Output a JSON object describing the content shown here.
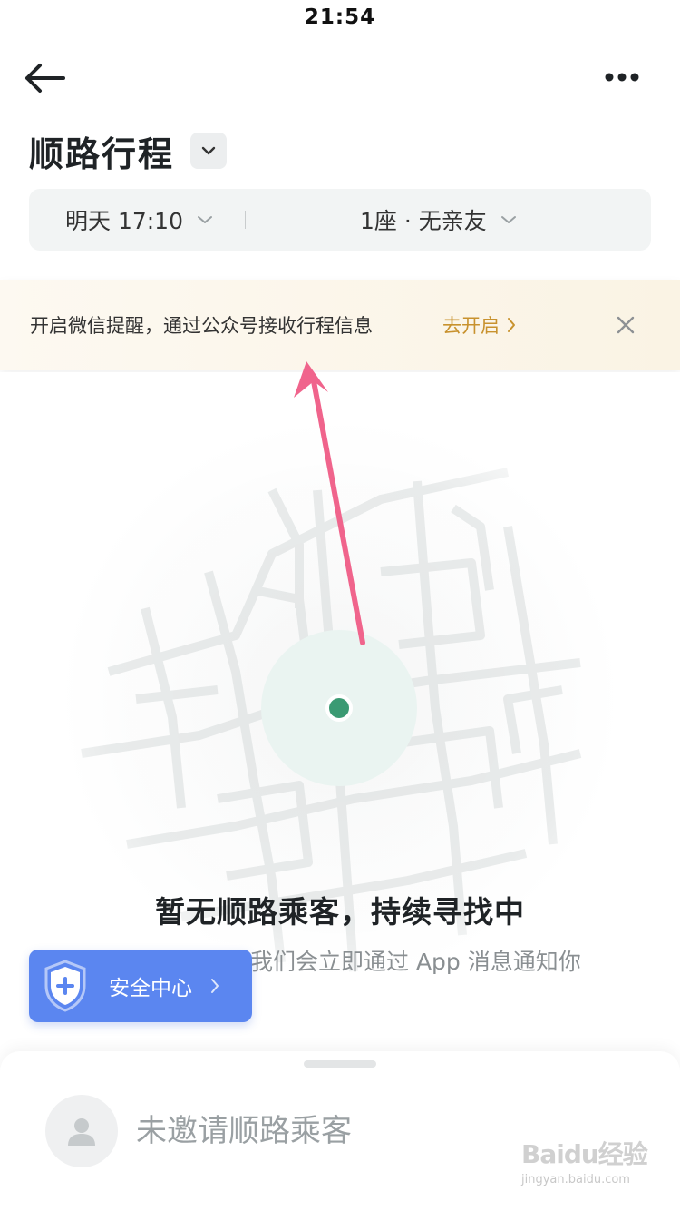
{
  "status_bar": {
    "time": "21:54"
  },
  "header": {
    "title": "顺路行程"
  },
  "trip": {
    "time": "明天 17:10",
    "seats": "1座 · 无亲友"
  },
  "banner": {
    "text": "开启微信提醒，通过公众号接收行程信息",
    "link": "去开启"
  },
  "empty_state": {
    "title": "暂无顺路乘客，持续寻找中",
    "subtitle": "我们会立即通过 App 消息通知你"
  },
  "safety": {
    "label": "安全中心"
  },
  "sheet": {
    "label": "未邀请顺路乘客"
  },
  "watermark": {
    "logo": "Baidu经验",
    "url": "jingyan.baidu.com"
  },
  "colors": {
    "accent_blue": "#5b86f0",
    "link_orange": "#c8922e",
    "location_green": "#3b9a73",
    "annotation_pink": "#f0648c"
  },
  "icons": [
    "back-arrow-icon",
    "more-icon",
    "chevron-down-icon",
    "close-icon",
    "shield-icon",
    "chevron-right-icon",
    "avatar-icon",
    "location-dot-icon"
  ]
}
